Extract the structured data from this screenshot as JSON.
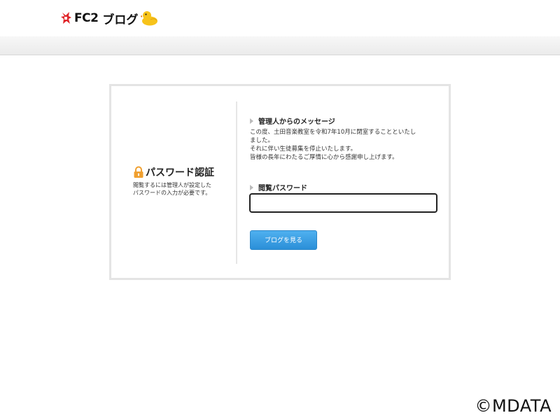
{
  "header": {
    "logo_fc2": "FC2",
    "logo_blog": "ブログ",
    "logo_mark_icon": "fc2-unicorn-logo-icon",
    "duck_icon": "duck-mascot-icon"
  },
  "auth": {
    "title": "パスワード認証",
    "description_lines": [
      "閲覧するには管理人が設定した",
      "パスワードの入力が必要です。"
    ],
    "lock_icon": "lock-icon"
  },
  "message": {
    "heading": "管理人からのメッセージ",
    "lines": [
      "この度、土田音楽教室を令和7年10月に閉室することといたし",
      "ました。",
      "それに伴い生徒募集を停止いたします。",
      "皆様の長年にわたるご厚情に心から感謝申し上げます。"
    ]
  },
  "password": {
    "heading": "閲覧パスワード",
    "value": "",
    "placeholder": ""
  },
  "button": {
    "label": "ブログを見る"
  },
  "watermark": {
    "text": "©MDATA"
  },
  "colors": {
    "button_blue": "#2b8fd8",
    "lock_orange": "#f0a030",
    "logo_red": "#e0262a"
  }
}
